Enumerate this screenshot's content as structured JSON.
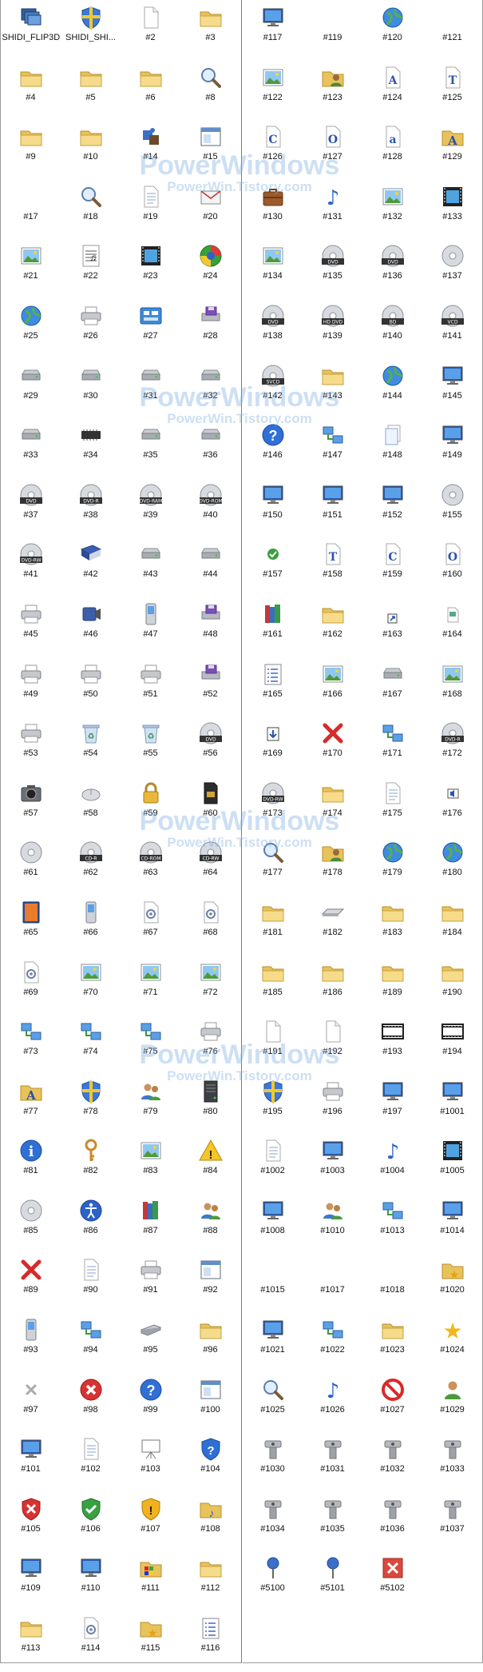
{
  "left_icons": [
    {
      "label": "SHIDI_FLIP3D",
      "icon": "flip3d-icon"
    },
    {
      "label": "SHIDI_SHI...",
      "icon": "shield-icon"
    },
    {
      "label": "#2",
      "icon": "blank-page-icon"
    },
    {
      "label": "#3",
      "icon": "folder-icon"
    },
    {
      "label": "#4",
      "icon": "folder-icon"
    },
    {
      "label": "#5",
      "icon": "folder-icon"
    },
    {
      "label": "#6",
      "icon": "folder-icon"
    },
    {
      "label": "#8",
      "icon": "search-icon"
    },
    {
      "label": "#9",
      "icon": "folder-icon"
    },
    {
      "label": "#10",
      "icon": "folder-icon"
    },
    {
      "label": "#14",
      "icon": "puzzle-icon"
    },
    {
      "label": "#15",
      "icon": "window-icon"
    },
    {
      "label": "#17",
      "icon": "none"
    },
    {
      "label": "#18",
      "icon": "search-icon"
    },
    {
      "label": "#19",
      "icon": "page-icon"
    },
    {
      "label": "#20",
      "icon": "envelope-icon"
    },
    {
      "label": "#21",
      "icon": "picture-icon"
    },
    {
      "label": "#22",
      "icon": "music-sheet-icon"
    },
    {
      "label": "#23",
      "icon": "film-icon"
    },
    {
      "label": "#24",
      "icon": "media-center-icon"
    },
    {
      "label": "#25",
      "icon": "globe-icon"
    },
    {
      "label": "#26",
      "icon": "printer-icon"
    },
    {
      "label": "#27",
      "icon": "control-panel-icon"
    },
    {
      "label": "#28",
      "icon": "floppy-drive-icon"
    },
    {
      "label": "#29",
      "icon": "drive-icon"
    },
    {
      "label": "#30",
      "icon": "drive-icon"
    },
    {
      "label": "#31",
      "icon": "drive-icon"
    },
    {
      "label": "#32",
      "icon": "drive-icon"
    },
    {
      "label": "#33",
      "icon": "drive-icon"
    },
    {
      "label": "#34",
      "icon": "chip-icon"
    },
    {
      "label": "#35",
      "icon": "drive-icon"
    },
    {
      "label": "#36",
      "icon": "drive-icon"
    },
    {
      "label": "#37",
      "icon": "disc-icon",
      "text": "DVD"
    },
    {
      "label": "#38",
      "icon": "disc-icon",
      "text": "DVD-R"
    },
    {
      "label": "#39",
      "icon": "disc-icon",
      "text": "DVD-RAM"
    },
    {
      "label": "#40",
      "icon": "disc-icon",
      "text": "DVD-ROM"
    },
    {
      "label": "#41",
      "icon": "disc-icon",
      "text": "DVD-RW"
    },
    {
      "label": "#42",
      "icon": "book-icon"
    },
    {
      "label": "#43",
      "icon": "drive-icon"
    },
    {
      "label": "#44",
      "icon": "drive-icon"
    },
    {
      "label": "#45",
      "icon": "printer-icon"
    },
    {
      "label": "#46",
      "icon": "camcorder-icon"
    },
    {
      "label": "#47",
      "icon": "phone-icon"
    },
    {
      "label": "#48",
      "icon": "floppy-drive-icon"
    },
    {
      "label": "#49",
      "icon": "printer-icon"
    },
    {
      "label": "#50",
      "icon": "printer-icon"
    },
    {
      "label": "#51",
      "icon": "printer-icon"
    },
    {
      "label": "#52",
      "icon": "floppy-drive-icon"
    },
    {
      "label": "#53",
      "icon": "printer-icon"
    },
    {
      "label": "#54",
      "icon": "recycle-bin-icon"
    },
    {
      "label": "#55",
      "icon": "recycle-bin-icon"
    },
    {
      "label": "#56",
      "icon": "disc-icon",
      "text": "DVD"
    },
    {
      "label": "#57",
      "icon": "camera-icon"
    },
    {
      "label": "#58",
      "icon": "mouse-icon"
    },
    {
      "label": "#59",
      "icon": "lock-icon"
    },
    {
      "label": "#60",
      "icon": "memory-card-icon"
    },
    {
      "label": "#61",
      "icon": "disc-icon"
    },
    {
      "label": "#62",
      "icon": "disc-icon",
      "text": "CD-R"
    },
    {
      "label": "#63",
      "icon": "disc-icon",
      "text": "CD-ROM"
    },
    {
      "label": "#64",
      "icon": "disc-icon",
      "text": "CD-RW"
    },
    {
      "label": "#65",
      "icon": "tablet-icon"
    },
    {
      "label": "#66",
      "icon": "phone-icon"
    },
    {
      "label": "#67",
      "icon": "settings-page-icon"
    },
    {
      "label": "#68",
      "icon": "settings-page-icon"
    },
    {
      "label": "#69",
      "icon": "settings-page-icon"
    },
    {
      "label": "#70",
      "icon": "picture-icon"
    },
    {
      "label": "#71",
      "icon": "picture-icon"
    },
    {
      "label": "#72",
      "icon": "picture-icon"
    },
    {
      "label": "#73",
      "icon": "network-icon"
    },
    {
      "label": "#74",
      "icon": "network-icon"
    },
    {
      "label": "#75",
      "icon": "network-icon"
    },
    {
      "label": "#76",
      "icon": "printer-icon"
    },
    {
      "label": "#77",
      "icon": "font-folder-icon"
    },
    {
      "label": "#78",
      "icon": "shield-icon"
    },
    {
      "label": "#79",
      "icon": "users-icon"
    },
    {
      "label": "#80",
      "icon": "server-icon"
    },
    {
      "label": "#81",
      "icon": "info-icon"
    },
    {
      "label": "#82",
      "icon": "key-icon"
    },
    {
      "label": "#83",
      "icon": "picture-icon"
    },
    {
      "label": "#84",
      "icon": "warning-icon"
    },
    {
      "label": "#85",
      "icon": "disc-icon"
    },
    {
      "label": "#86",
      "icon": "accessibility-icon"
    },
    {
      "label": "#87",
      "icon": "books-icon"
    },
    {
      "label": "#88",
      "icon": "users-icon"
    },
    {
      "label": "#89",
      "icon": "x-icon"
    },
    {
      "label": "#90",
      "icon": "page-icon"
    },
    {
      "label": "#91",
      "icon": "printer-icon"
    },
    {
      "label": "#92",
      "icon": "window-icon"
    },
    {
      "label": "#93",
      "icon": "phone-icon"
    },
    {
      "label": "#94",
      "icon": "network-icon"
    },
    {
      "label": "#95",
      "icon": "scanner-icon"
    },
    {
      "label": "#96",
      "icon": "folder-icon"
    },
    {
      "label": "#97",
      "icon": "small-x-icon"
    },
    {
      "label": "#98",
      "icon": "error-icon"
    },
    {
      "label": "#99",
      "icon": "help-icon"
    },
    {
      "label": "#100",
      "icon": "window-icon"
    },
    {
      "label": "#101",
      "icon": "monitor-icon"
    },
    {
      "label": "#102",
      "icon": "page-icon"
    },
    {
      "label": "#103",
      "icon": "projector-screen-icon"
    },
    {
      "label": "#104",
      "icon": "shield-help-icon"
    },
    {
      "label": "#105",
      "icon": "shield-error-icon"
    },
    {
      "label": "#106",
      "icon": "shield-check-icon"
    },
    {
      "label": "#107",
      "icon": "shield-warning-icon"
    },
    {
      "label": "#108",
      "icon": "music-folder-icon"
    },
    {
      "label": "#109",
      "icon": "monitor-icon"
    },
    {
      "label": "#110",
      "icon": "monitor-icon"
    },
    {
      "label": "#111",
      "icon": "game-folder-icon"
    },
    {
      "label": "#112",
      "icon": "folder-icon"
    },
    {
      "label": "#113",
      "icon": "folder-icon"
    },
    {
      "label": "#114",
      "icon": "settings-page-icon"
    },
    {
      "label": "#115",
      "icon": "star-folder-icon"
    },
    {
      "label": "#116",
      "icon": "list-icon"
    }
  ],
  "right_icons": [
    {
      "label": "#117",
      "icon": "monitor-icon"
    },
    {
      "label": "#119",
      "icon": "none"
    },
    {
      "label": "#120",
      "icon": "globe-icon"
    },
    {
      "label": "#121",
      "icon": "none"
    },
    {
      "label": "#122",
      "icon": "picture-icon"
    },
    {
      "label": "#123",
      "icon": "user-folder-icon"
    },
    {
      "label": "#124",
      "icon": "font-icon",
      "text": "A"
    },
    {
      "label": "#125",
      "icon": "font-icon",
      "text": "T"
    },
    {
      "label": "#126",
      "icon": "font-icon",
      "text": "C"
    },
    {
      "label": "#127",
      "icon": "font-icon",
      "text": "O"
    },
    {
      "label": "#128",
      "icon": "font-icon",
      "text": "a"
    },
    {
      "label": "#129",
      "icon": "font-folder-icon"
    },
    {
      "label": "#130",
      "icon": "briefcase-icon"
    },
    {
      "label": "#131",
      "icon": "music-icon"
    },
    {
      "label": "#132",
      "icon": "picture-icon"
    },
    {
      "label": "#133",
      "icon": "film-icon"
    },
    {
      "label": "#134",
      "icon": "picture-icon"
    },
    {
      "label": "#135",
      "icon": "disc-icon",
      "text": "DVD"
    },
    {
      "label": "#136",
      "icon": "disc-icon",
      "text": "DVD"
    },
    {
      "label": "#137",
      "icon": "disc-icon"
    },
    {
      "label": "#138",
      "icon": "disc-icon",
      "text": "DVD"
    },
    {
      "label": "#139",
      "icon": "disc-icon",
      "text": "HD DVD"
    },
    {
      "label": "#140",
      "icon": "disc-icon",
      "text": "BD"
    },
    {
      "label": "#141",
      "icon": "disc-icon",
      "text": "VCD"
    },
    {
      "label": "#142",
      "icon": "disc-icon",
      "text": "SVCD"
    },
    {
      "label": "#143",
      "icon": "folder-icon"
    },
    {
      "label": "#144",
      "icon": "globe-icon"
    },
    {
      "label": "#145",
      "icon": "monitor-icon"
    },
    {
      "label": "#146",
      "icon": "help-icon"
    },
    {
      "label": "#147",
      "icon": "network-icon"
    },
    {
      "label": "#148",
      "icon": "pages-icon"
    },
    {
      "label": "#149",
      "icon": "monitor-icon"
    },
    {
      "label": "#150",
      "icon": "monitor-icon"
    },
    {
      "label": "#151",
      "icon": "monitor-icon"
    },
    {
      "label": "#152",
      "icon": "monitor-icon"
    },
    {
      "label": "#155",
      "icon": "disc-icon"
    },
    {
      "label": "#157",
      "icon": "check-icon"
    },
    {
      "label": "#158",
      "icon": "font-icon",
      "text": "T"
    },
    {
      "label": "#159",
      "icon": "font-icon",
      "text": "C"
    },
    {
      "label": "#160",
      "icon": "font-icon",
      "text": "O"
    },
    {
      "label": "#161",
      "icon": "books-icon"
    },
    {
      "label": "#162",
      "icon": "folder-icon"
    },
    {
      "label": "#163",
      "icon": "shortcut-icon"
    },
    {
      "label": "#164",
      "icon": "small-page-icon"
    },
    {
      "label": "#165",
      "icon": "list-icon"
    },
    {
      "label": "#166",
      "icon": "picture-icon"
    },
    {
      "label": "#167",
      "icon": "drive-icon"
    },
    {
      "label": "#168",
      "icon": "picture-icon"
    },
    {
      "label": "#169",
      "icon": "download-icon"
    },
    {
      "label": "#170",
      "icon": "x-icon"
    },
    {
      "label": "#171",
      "icon": "network-icon"
    },
    {
      "label": "#172",
      "icon": "disc-icon",
      "text": "DVD-R"
    },
    {
      "label": "#173",
      "icon": "disc-icon",
      "text": "DVD-RW"
    },
    {
      "label": "#174",
      "icon": "folder-icon"
    },
    {
      "label": "#175",
      "icon": "page-icon"
    },
    {
      "label": "#176",
      "icon": "speaker-icon"
    },
    {
      "label": "#177",
      "icon": "search-icon"
    },
    {
      "label": "#178",
      "icon": "user-folder-icon"
    },
    {
      "label": "#179",
      "icon": "globe-icon"
    },
    {
      "label": "#180",
      "icon": "globe-icon"
    },
    {
      "label": "#181",
      "icon": "folder-icon"
    },
    {
      "label": "#182",
      "icon": "keyboard-icon"
    },
    {
      "label": "#183",
      "icon": "folder-icon"
    },
    {
      "label": "#184",
      "icon": "folder-icon"
    },
    {
      "label": "#185",
      "icon": "folder-icon"
    },
    {
      "label": "#186",
      "icon": "folder-icon"
    },
    {
      "label": "#189",
      "icon": "folder-icon"
    },
    {
      "label": "#190",
      "icon": "folder-icon"
    },
    {
      "label": "#191",
      "icon": "blank-page-icon"
    },
    {
      "label": "#192",
      "icon": "blank-page-icon"
    },
    {
      "label": "#193",
      "icon": "film-strip-icon"
    },
    {
      "label": "#194",
      "icon": "film-strip-icon"
    },
    {
      "label": "#195",
      "icon": "shield-icon"
    },
    {
      "label": "#196",
      "icon": "printer-icon"
    },
    {
      "label": "#197",
      "icon": "monitor-icon"
    },
    {
      "label": "#1001",
      "icon": "monitor-icon"
    },
    {
      "label": "#1002",
      "icon": "page-icon"
    },
    {
      "label": "#1003",
      "icon": "monitor-icon"
    },
    {
      "label": "#1004",
      "icon": "music-icon"
    },
    {
      "label": "#1005",
      "icon": "film-icon"
    },
    {
      "label": "#1008",
      "icon": "monitor-icon"
    },
    {
      "label": "#1010",
      "icon": "users-icon"
    },
    {
      "label": "#1013",
      "icon": "network-icon"
    },
    {
      "label": "#1014",
      "icon": "monitor-icon"
    },
    {
      "label": "#1015",
      "icon": "none"
    },
    {
      "label": "#1017",
      "icon": "none"
    },
    {
      "label": "#1018",
      "icon": "none"
    },
    {
      "label": "#1020",
      "icon": "star-folder-icon"
    },
    {
      "label": "#1021",
      "icon": "monitor-icon"
    },
    {
      "label": "#1022",
      "icon": "network-icon"
    },
    {
      "label": "#1023",
      "icon": "folder-icon"
    },
    {
      "label": "#1024",
      "icon": "star-icon"
    },
    {
      "label": "#1025",
      "icon": "search-icon"
    },
    {
      "label": "#1026",
      "icon": "music-icon"
    },
    {
      "label": "#1027",
      "icon": "no-entry-icon"
    },
    {
      "label": "#1029",
      "icon": "user-icon"
    },
    {
      "label": "#1030",
      "icon": "pipe-icon"
    },
    {
      "label": "#1031",
      "icon": "pipe-icon"
    },
    {
      "label": "#1032",
      "icon": "pipe-icon"
    },
    {
      "label": "#1033",
      "icon": "pipe-icon"
    },
    {
      "label": "#1034",
      "icon": "pipe-icon"
    },
    {
      "label": "#1035",
      "icon": "pipe-icon"
    },
    {
      "label": "#1036",
      "icon": "pipe-icon"
    },
    {
      "label": "#1037",
      "icon": "pipe-icon"
    },
    {
      "label": "#5100",
      "icon": "pin-icon"
    },
    {
      "label": "#5101",
      "icon": "pin-icon"
    },
    {
      "label": "#5102",
      "icon": "close-box-icon"
    }
  ],
  "watermark": {
    "line1": "PowerWindows",
    "line2": "PowerWin.Tistory.com"
  },
  "colors": {
    "label_text": "#111111",
    "watermark": "#78aae1",
    "divider": "#7d7d7d"
  }
}
